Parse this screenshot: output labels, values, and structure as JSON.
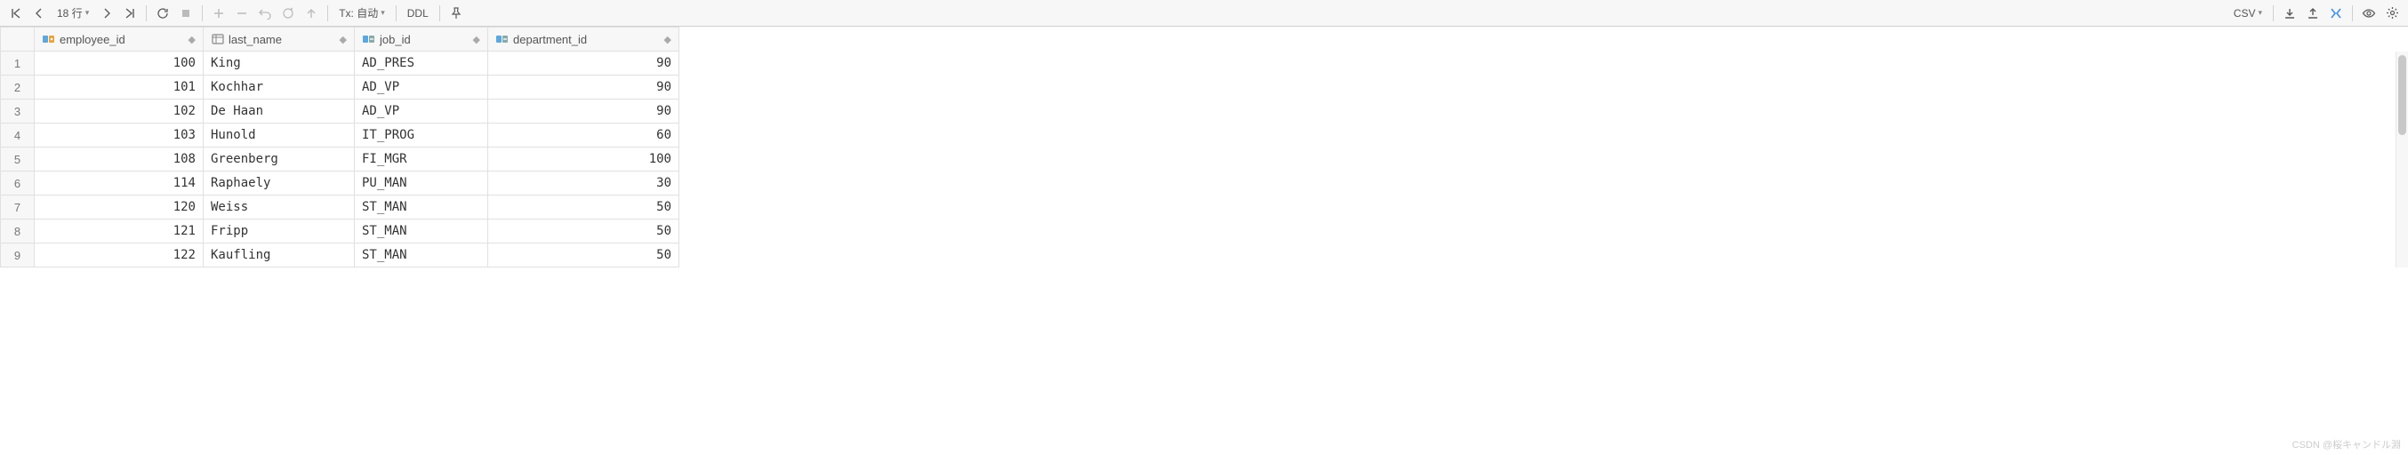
{
  "toolbar": {
    "row_count_label": "18 行",
    "tx_label": "Tx: 自动",
    "ddl_label": "DDL",
    "csv_label": "CSV"
  },
  "columns": [
    {
      "name": "employee_id",
      "type": "pk"
    },
    {
      "name": "last_name",
      "type": "text"
    },
    {
      "name": "job_id",
      "type": "fk"
    },
    {
      "name": "department_id",
      "type": "fk"
    }
  ],
  "rows": [
    {
      "n": "1",
      "employee_id": "100",
      "last_name": "King",
      "job_id": "AD_PRES",
      "department_id": "90"
    },
    {
      "n": "2",
      "employee_id": "101",
      "last_name": "Kochhar",
      "job_id": "AD_VP",
      "department_id": "90"
    },
    {
      "n": "3",
      "employee_id": "102",
      "last_name": "De Haan",
      "job_id": "AD_VP",
      "department_id": "90"
    },
    {
      "n": "4",
      "employee_id": "103",
      "last_name": "Hunold",
      "job_id": "IT_PROG",
      "department_id": "60"
    },
    {
      "n": "5",
      "employee_id": "108",
      "last_name": "Greenberg",
      "job_id": "FI_MGR",
      "department_id": "100"
    },
    {
      "n": "6",
      "employee_id": "114",
      "last_name": "Raphaely",
      "job_id": "PU_MAN",
      "department_id": "30"
    },
    {
      "n": "7",
      "employee_id": "120",
      "last_name": "Weiss",
      "job_id": "ST_MAN",
      "department_id": "50"
    },
    {
      "n": "8",
      "employee_id": "121",
      "last_name": "Fripp",
      "job_id": "ST_MAN",
      "department_id": "50"
    },
    {
      "n": "9",
      "employee_id": "122",
      "last_name": "Kaufling",
      "job_id": "ST_MAN",
      "department_id": "50"
    }
  ],
  "watermark": "CSDN @桜キャンドル淵"
}
